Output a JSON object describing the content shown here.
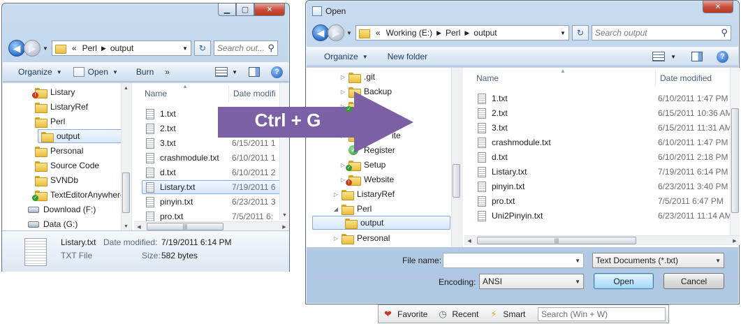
{
  "explorer": {
    "path": [
      "«",
      "Perl",
      "output"
    ],
    "search_placeholder": "Search out...",
    "toolbar": {
      "organize": "Organize",
      "open": "Open",
      "burn": "Burn",
      "more": "»"
    },
    "tree": [
      {
        "label": "Listary",
        "icon": "folder-red"
      },
      {
        "label": "ListaryRef",
        "icon": "folder"
      },
      {
        "label": "Perl",
        "icon": "folder"
      },
      {
        "label": "output",
        "icon": "folder",
        "selected": true
      },
      {
        "label": "Personal",
        "icon": "folder"
      },
      {
        "label": "Source Code",
        "icon": "folder"
      },
      {
        "label": "SVNDb",
        "icon": "folder"
      },
      {
        "label": "TextEditorAnywhere",
        "icon": "folder-green"
      },
      {
        "label": "Download (F:)",
        "icon": "drive"
      },
      {
        "label": "Data (G:)",
        "icon": "drive"
      }
    ],
    "columns": {
      "name": "Name",
      "date": "Date modifi"
    },
    "files": [
      {
        "name": "1.txt",
        "date": ""
      },
      {
        "name": "2.txt",
        "date": ""
      },
      {
        "name": "3.txt",
        "date": "6/15/2011 1"
      },
      {
        "name": "crashmodule.txt",
        "date": "6/10/2011 1"
      },
      {
        "name": "d.txt",
        "date": "6/10/2011 2"
      },
      {
        "name": "Listary.txt",
        "date": "7/19/2011 6",
        "selected": true
      },
      {
        "name": "pinyin.txt",
        "date": "6/23/2011 3"
      },
      {
        "name": "pro.txt",
        "date": "7/5/2011 6:"
      }
    ],
    "details": {
      "filename": "Listary.txt",
      "type": "TXT File",
      "date_label": "Date modified:",
      "date_value": "7/19/2011 6:14 PM",
      "size_label": "Size:",
      "size_value": "582 bytes"
    }
  },
  "overlay": {
    "shortcut": "Ctrl + G",
    "color": "#7b60a6"
  },
  "open_dialog": {
    "title": "Open",
    "path": [
      "«",
      "Working (E:)",
      "Perl",
      "output"
    ],
    "search_placeholder": "Search output",
    "toolbar": {
      "organize": "Organize",
      "new_folder": "New folder"
    },
    "tree": [
      {
        "label": ".git",
        "icon": "folder",
        "indent": 2,
        "expander": "▷"
      },
      {
        "label": "Backup",
        "icon": "folder",
        "indent": 2,
        "expander": "▷"
      },
      {
        "label": "L",
        "icon": "folder-green",
        "indent": 2,
        "expander": "▷"
      },
      {
        "label": "",
        "icon": "folder",
        "indent": 2,
        "expander": "▷"
      },
      {
        "label": "ite",
        "icon": "folder",
        "indent": 2,
        "expander": "▷"
      },
      {
        "label": "Register",
        "icon": "green-check",
        "indent": 2,
        "expander": ""
      },
      {
        "label": "Setup",
        "icon": "folder-green",
        "indent": 2,
        "expander": "▷"
      },
      {
        "label": "Website",
        "icon": "folder-red",
        "indent": 2,
        "expander": "▷"
      },
      {
        "label": "ListaryRef",
        "icon": "folder",
        "indent": 1,
        "expander": "▷"
      },
      {
        "label": "Perl",
        "icon": "folder",
        "indent": 1,
        "expander": "◢"
      },
      {
        "label": "output",
        "icon": "folder",
        "indent": 2,
        "expander": "",
        "selected": true
      },
      {
        "label": "Personal",
        "icon": "folder",
        "indent": 1,
        "expander": "▷"
      }
    ],
    "columns": {
      "name": "Name",
      "date": "Date modified"
    },
    "files": [
      {
        "name": "1.txt",
        "date": "6/10/2011 1:47 PM"
      },
      {
        "name": "2.txt",
        "date": "6/15/2011 10:36 AM"
      },
      {
        "name": "3.txt",
        "date": "6/15/2011 11:31 AM"
      },
      {
        "name": "crashmodule.txt",
        "date": "6/10/2011 1:47 PM"
      },
      {
        "name": "d.txt",
        "date": "6/10/2011 2:18 PM"
      },
      {
        "name": "Listary.txt",
        "date": "7/19/2011 6:14 PM"
      },
      {
        "name": "pinyin.txt",
        "date": "6/23/2011 3:40 PM"
      },
      {
        "name": "pro.txt",
        "date": "7/5/2011 6:47 PM"
      },
      {
        "name": "Uni2Pinyin.txt",
        "date": "6/23/2011 11:14 AM"
      }
    ],
    "filename_label": "File name:",
    "filename_value": "",
    "filetype_value": "Text Documents (*.txt)",
    "encoding_label": "Encoding:",
    "encoding_value": "ANSI",
    "open_button": "Open",
    "cancel_button": "Cancel"
  },
  "listary_bar": {
    "favorite": "Favorite",
    "recent": "Recent",
    "smart": "Smart",
    "search_placeholder": "Search (Win + W)"
  }
}
